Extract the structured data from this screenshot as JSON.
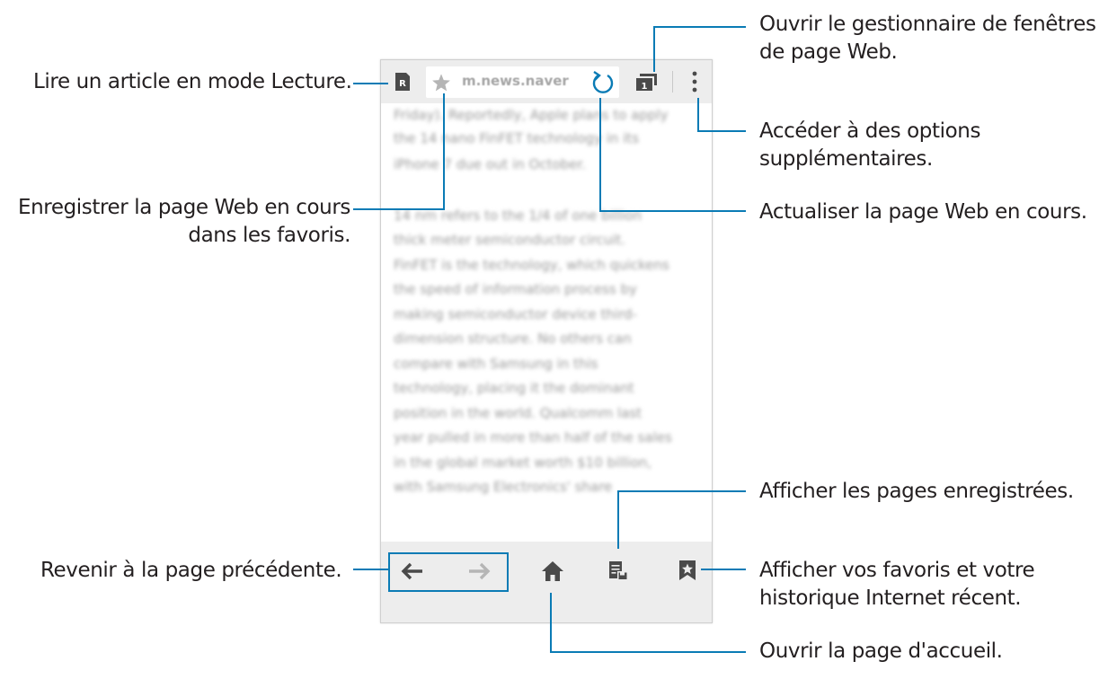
{
  "phone": {
    "url_text": "m.news.naver",
    "tab_count": "1",
    "reader_letter": "R",
    "article_lines": [
      "Friday). Reportedly, Apple plans to apply",
      "the 14 nano FinFET technology in its",
      "iPhone 7 due out in October.",
      "",
      "14 nm refers to the 1/4 of one billion",
      "thick meter semiconductor circuit.",
      "FinFET is the technology, which quickens",
      "the speed of information process by",
      "making semiconductor device third-",
      "dimension structure. No others can",
      "compare with Samsung in this",
      "technology, placing it the dominant",
      "position in the world. Qualcomm last",
      "year pulled in more than half of the sales",
      "in the global market worth $10 billion,",
      "with Samsung Electronics' share"
    ]
  },
  "callouts": {
    "reader": "Lire un article en mode Lecture.",
    "bookmark_line1": "Enregistrer la page Web en cours",
    "bookmark_line2": "dans les favoris.",
    "back": "Revenir à la page précédente.",
    "window_manager_line1": "Ouvrir le gestionnaire de fenêtres",
    "window_manager_line2": "de page Web.",
    "options_line1": "Accéder à des options",
    "options_line2": "supplémentaires.",
    "refresh": "Actualiser la page Web en cours.",
    "saved_pages": "Afficher les pages enregistrées.",
    "favorites_line1": "Afficher vos favoris et votre",
    "favorites_line2": "historique Internet récent.",
    "home": "Ouvrir la page d'accueil."
  },
  "colors": {
    "leader_line": "#0a7bb5",
    "bar_background": "#ededed",
    "icon_gray": "#4a4a4a",
    "accent": "#0a7bb5"
  },
  "icons": {
    "reader": "reader-mode-icon",
    "star": "star-icon",
    "refresh": "refresh-icon",
    "tabs": "window-manager-icon",
    "menu": "more-options-icon",
    "back": "back-arrow-icon",
    "forward": "forward-arrow-icon",
    "home": "home-icon",
    "saved": "saved-pages-icon",
    "bookmarks": "bookmarks-icon"
  }
}
